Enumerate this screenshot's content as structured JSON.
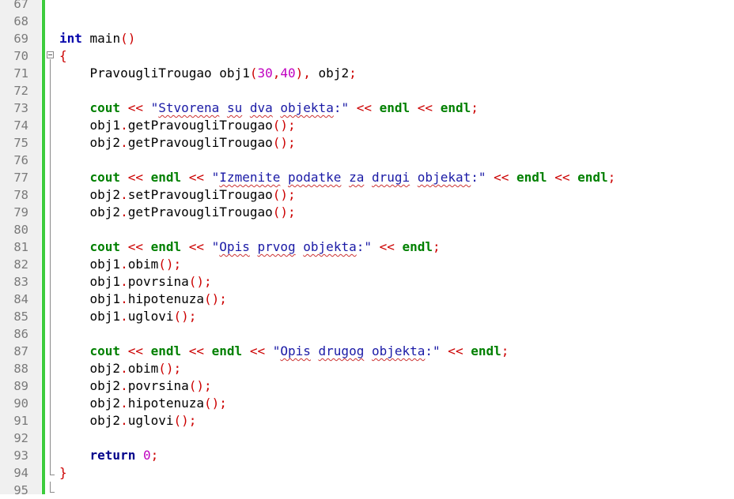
{
  "editor": {
    "lines": [
      {
        "n": "67",
        "tokens": []
      },
      {
        "n": "68",
        "tokens": []
      },
      {
        "n": "69",
        "tokens": [
          {
            "t": "int",
            "c": "kw-type"
          },
          {
            "t": " main",
            "c": ""
          },
          {
            "t": "()",
            "c": "op"
          }
        ]
      },
      {
        "n": "70",
        "fold": "start",
        "tokens": [
          {
            "t": "{",
            "c": "op"
          }
        ]
      },
      {
        "n": "71",
        "tokens": [
          {
            "t": "    PravougliTrougao obj1",
            "c": ""
          },
          {
            "t": "(",
            "c": "op"
          },
          {
            "t": "30",
            "c": "num"
          },
          {
            "t": ",",
            "c": "op"
          },
          {
            "t": "40",
            "c": "num"
          },
          {
            "t": "),",
            "c": "op"
          },
          {
            "t": " obj2",
            "c": ""
          },
          {
            "t": ";",
            "c": "op"
          }
        ]
      },
      {
        "n": "72",
        "tokens": []
      },
      {
        "n": "73",
        "tokens": [
          {
            "t": "    ",
            "c": ""
          },
          {
            "t": "cout",
            "c": "kw-green"
          },
          {
            "t": " << ",
            "c": "op"
          },
          {
            "t": "\"",
            "c": "str"
          },
          {
            "t": "Stvorena",
            "c": "str sq"
          },
          {
            "t": " ",
            "c": "str"
          },
          {
            "t": "su",
            "c": "str sq"
          },
          {
            "t": " ",
            "c": "str"
          },
          {
            "t": "dva",
            "c": "str sq"
          },
          {
            "t": " ",
            "c": "str"
          },
          {
            "t": "objekta",
            "c": "str sq"
          },
          {
            "t": ":\"",
            "c": "str"
          },
          {
            "t": " << ",
            "c": "op"
          },
          {
            "t": "endl",
            "c": "kw-green"
          },
          {
            "t": " << ",
            "c": "op"
          },
          {
            "t": "endl",
            "c": "kw-green"
          },
          {
            "t": ";",
            "c": "op"
          }
        ]
      },
      {
        "n": "74",
        "tokens": [
          {
            "t": "    obj1",
            "c": ""
          },
          {
            "t": ".",
            "c": "op"
          },
          {
            "t": "getPravougliTrougao",
            "c": ""
          },
          {
            "t": "();",
            "c": "op"
          }
        ]
      },
      {
        "n": "75",
        "tokens": [
          {
            "t": "    obj2",
            "c": ""
          },
          {
            "t": ".",
            "c": "op"
          },
          {
            "t": "getPravougliTrougao",
            "c": ""
          },
          {
            "t": "();",
            "c": "op"
          }
        ]
      },
      {
        "n": "76",
        "tokens": []
      },
      {
        "n": "77",
        "tokens": [
          {
            "t": "    ",
            "c": ""
          },
          {
            "t": "cout",
            "c": "kw-green"
          },
          {
            "t": " << ",
            "c": "op"
          },
          {
            "t": "endl",
            "c": "kw-green"
          },
          {
            "t": " << ",
            "c": "op"
          },
          {
            "t": "\"",
            "c": "str"
          },
          {
            "t": "Izmenite",
            "c": "str sq"
          },
          {
            "t": " ",
            "c": "str"
          },
          {
            "t": "podatke",
            "c": "str sq"
          },
          {
            "t": " ",
            "c": "str"
          },
          {
            "t": "za",
            "c": "str sq"
          },
          {
            "t": " ",
            "c": "str"
          },
          {
            "t": "drugi",
            "c": "str sq"
          },
          {
            "t": " ",
            "c": "str"
          },
          {
            "t": "objekat",
            "c": "str sq"
          },
          {
            "t": ":\"",
            "c": "str"
          },
          {
            "t": " << ",
            "c": "op"
          },
          {
            "t": "endl",
            "c": "kw-green"
          },
          {
            "t": " << ",
            "c": "op"
          },
          {
            "t": "endl",
            "c": "kw-green"
          },
          {
            "t": ";",
            "c": "op"
          }
        ]
      },
      {
        "n": "78",
        "tokens": [
          {
            "t": "    obj2",
            "c": ""
          },
          {
            "t": ".",
            "c": "op"
          },
          {
            "t": "setPravougliTrougao",
            "c": ""
          },
          {
            "t": "();",
            "c": "op"
          }
        ]
      },
      {
        "n": "79",
        "tokens": [
          {
            "t": "    obj2",
            "c": ""
          },
          {
            "t": ".",
            "c": "op"
          },
          {
            "t": "getPravougliTrougao",
            "c": ""
          },
          {
            "t": "();",
            "c": "op"
          }
        ]
      },
      {
        "n": "80",
        "tokens": []
      },
      {
        "n": "81",
        "tokens": [
          {
            "t": "    ",
            "c": ""
          },
          {
            "t": "cout",
            "c": "kw-green"
          },
          {
            "t": " << ",
            "c": "op"
          },
          {
            "t": "endl",
            "c": "kw-green"
          },
          {
            "t": " << ",
            "c": "op"
          },
          {
            "t": "\"",
            "c": "str"
          },
          {
            "t": "Opis",
            "c": "str sq"
          },
          {
            "t": " ",
            "c": "str"
          },
          {
            "t": "prvog",
            "c": "str sq"
          },
          {
            "t": " ",
            "c": "str"
          },
          {
            "t": "objekta",
            "c": "str sq"
          },
          {
            "t": ":\"",
            "c": "str"
          },
          {
            "t": " << ",
            "c": "op"
          },
          {
            "t": "endl",
            "c": "kw-green"
          },
          {
            "t": ";",
            "c": "op"
          }
        ]
      },
      {
        "n": "82",
        "tokens": [
          {
            "t": "    obj1",
            "c": ""
          },
          {
            "t": ".",
            "c": "op"
          },
          {
            "t": "obim",
            "c": ""
          },
          {
            "t": "();",
            "c": "op"
          }
        ]
      },
      {
        "n": "83",
        "tokens": [
          {
            "t": "    obj1",
            "c": ""
          },
          {
            "t": ".",
            "c": "op"
          },
          {
            "t": "povrsina",
            "c": ""
          },
          {
            "t": "();",
            "c": "op"
          }
        ]
      },
      {
        "n": "84",
        "tokens": [
          {
            "t": "    obj1",
            "c": ""
          },
          {
            "t": ".",
            "c": "op"
          },
          {
            "t": "hipotenuza",
            "c": ""
          },
          {
            "t": "();",
            "c": "op"
          }
        ]
      },
      {
        "n": "85",
        "tokens": [
          {
            "t": "    obj1",
            "c": ""
          },
          {
            "t": ".",
            "c": "op"
          },
          {
            "t": "uglovi",
            "c": ""
          },
          {
            "t": "();",
            "c": "op"
          }
        ]
      },
      {
        "n": "86",
        "tokens": []
      },
      {
        "n": "87",
        "tokens": [
          {
            "t": "    ",
            "c": ""
          },
          {
            "t": "cout",
            "c": "kw-green"
          },
          {
            "t": " << ",
            "c": "op"
          },
          {
            "t": "endl",
            "c": "kw-green"
          },
          {
            "t": " << ",
            "c": "op"
          },
          {
            "t": "endl",
            "c": "kw-green"
          },
          {
            "t": " << ",
            "c": "op"
          },
          {
            "t": "\"",
            "c": "str"
          },
          {
            "t": "Opis",
            "c": "str sq"
          },
          {
            "t": " ",
            "c": "str"
          },
          {
            "t": "drugog",
            "c": "str sq"
          },
          {
            "t": " ",
            "c": "str"
          },
          {
            "t": "objekta",
            "c": "str sq"
          },
          {
            "t": ":\"",
            "c": "str"
          },
          {
            "t": " << ",
            "c": "op"
          },
          {
            "t": "endl",
            "c": "kw-green"
          },
          {
            "t": ";",
            "c": "op"
          }
        ]
      },
      {
        "n": "88",
        "tokens": [
          {
            "t": "    obj2",
            "c": ""
          },
          {
            "t": ".",
            "c": "op"
          },
          {
            "t": "obim",
            "c": ""
          },
          {
            "t": "();",
            "c": "op"
          }
        ]
      },
      {
        "n": "89",
        "tokens": [
          {
            "t": "    obj2",
            "c": ""
          },
          {
            "t": ".",
            "c": "op"
          },
          {
            "t": "povrsina",
            "c": ""
          },
          {
            "t": "();",
            "c": "op"
          }
        ]
      },
      {
        "n": "90",
        "tokens": [
          {
            "t": "    obj2",
            "c": ""
          },
          {
            "t": ".",
            "c": "op"
          },
          {
            "t": "hipotenuza",
            "c": ""
          },
          {
            "t": "();",
            "c": "op"
          }
        ]
      },
      {
        "n": "91",
        "tokens": [
          {
            "t": "    obj2",
            "c": ""
          },
          {
            "t": ".",
            "c": "op"
          },
          {
            "t": "uglovi",
            "c": ""
          },
          {
            "t": "();",
            "c": "op"
          }
        ]
      },
      {
        "n": "92",
        "tokens": []
      },
      {
        "n": "93",
        "tokens": [
          {
            "t": "    ",
            "c": ""
          },
          {
            "t": "return",
            "c": "kw-ret"
          },
          {
            "t": " ",
            "c": ""
          },
          {
            "t": "0",
            "c": "num"
          },
          {
            "t": ";",
            "c": "op"
          }
        ]
      },
      {
        "n": "94",
        "fold": "end",
        "tokens": [
          {
            "t": "}",
            "c": "op"
          }
        ]
      },
      {
        "n": "95",
        "fold": "tail",
        "tokens": []
      }
    ]
  },
  "colors": {
    "gutter_bg": "#f0f0f0",
    "change_bar": "#3dcc3d",
    "keyword_type": "#0000aa",
    "keyword_green": "#008000",
    "operator": "#cc0000",
    "number": "#c000c0",
    "string": "#1a1aa6"
  }
}
